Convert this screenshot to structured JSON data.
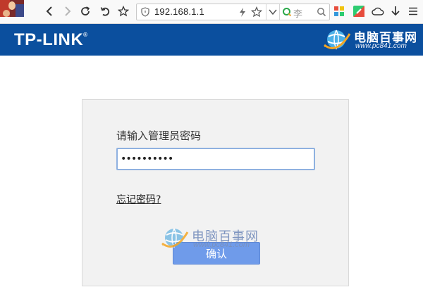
{
  "browser": {
    "url": "192.168.1.1",
    "search_text": "李"
  },
  "header": {
    "brand": "TP-LINK",
    "watermark_cn": "电脑百事网",
    "watermark_en": "www.pc841.com"
  },
  "login": {
    "prompt": "请输入管理员密码",
    "password_value": "••••••••••",
    "forgot_link": "忘记密码?",
    "confirm_label": "确认"
  },
  "watermark": {
    "cn": "电脑百事网",
    "en": "www.pc841.com"
  },
  "icons": {
    "back": "chevron-left-icon",
    "forward": "chevron-right-icon",
    "reload": "reload-icon",
    "undo": "undo-icon",
    "bookmark": "star-icon",
    "shield": "shield-icon",
    "flash": "lightning-icon",
    "search": "magnifier-icon",
    "apps": "apps-grid-icon",
    "cloud": "cloud-icon",
    "download": "download-icon",
    "menu": "menu-icon"
  },
  "colors": {
    "banner": "#0b4f9e",
    "button": "#6f9bea",
    "input_border": "#8fb1e0"
  }
}
